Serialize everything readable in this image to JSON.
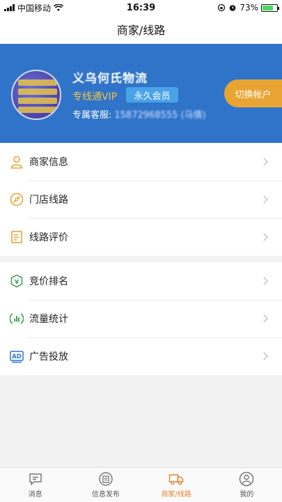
{
  "status_bar": {
    "carrier": "中国移动",
    "time": "16:39",
    "battery": "73%"
  },
  "nav": {
    "title": "商家/线路"
  },
  "profile": {
    "company_name": "义乌何氏物流",
    "vip_label": "专线通VIP",
    "member_badge": "永久会员",
    "service_label": "专属客服:",
    "service_value": "15872968555 (马倩)",
    "switch_account": "切换帐户",
    "avatar_text": [
      "北京",
      "天津",
      "包头",
      "兰州"
    ]
  },
  "menu_group_1": [
    {
      "label": "商家信息",
      "icon": "user-icon"
    },
    {
      "label": "门店线路",
      "icon": "compass-icon"
    },
    {
      "label": "线路评价",
      "icon": "document-icon"
    }
  ],
  "menu_group_2": [
    {
      "label": "竞价排名",
      "icon": "rank-shield-icon"
    },
    {
      "label": "流量统计",
      "icon": "chart-icon"
    },
    {
      "label": "广告投放",
      "icon": "ad-icon"
    }
  ],
  "tabs": [
    {
      "label": "消息",
      "icon": "message-icon",
      "active": false
    },
    {
      "label": "信息发布",
      "icon": "publish-icon",
      "active": false
    },
    {
      "label": "商家/线路",
      "icon": "truck-icon",
      "active": true
    },
    {
      "label": "我的",
      "icon": "profile-icon",
      "active": false
    }
  ],
  "colors": {
    "accent": "#e8a533",
    "banner": "#2f74c9",
    "vip": "#f5c342",
    "active_tab": "#e8822f"
  }
}
